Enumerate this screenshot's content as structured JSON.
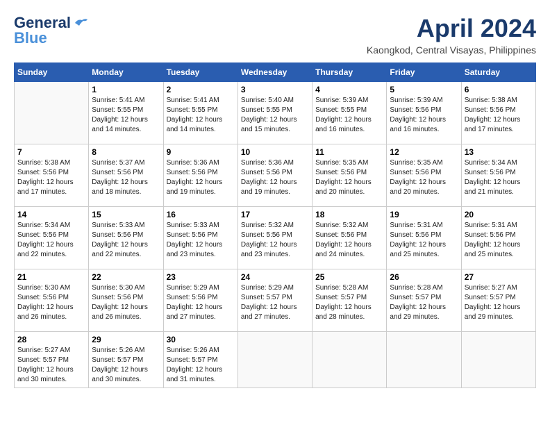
{
  "header": {
    "logo_line1": "General",
    "logo_line2": "Blue",
    "month": "April 2024",
    "location": "Kaongkod, Central Visayas, Philippines"
  },
  "weekdays": [
    "Sunday",
    "Monday",
    "Tuesday",
    "Wednesday",
    "Thursday",
    "Friday",
    "Saturday"
  ],
  "weeks": [
    [
      {
        "day": "",
        "sunrise": "",
        "sunset": "",
        "daylight": ""
      },
      {
        "day": "1",
        "sunrise": "Sunrise: 5:41 AM",
        "sunset": "Sunset: 5:55 PM",
        "daylight": "Daylight: 12 hours and 14 minutes."
      },
      {
        "day": "2",
        "sunrise": "Sunrise: 5:41 AM",
        "sunset": "Sunset: 5:55 PM",
        "daylight": "Daylight: 12 hours and 14 minutes."
      },
      {
        "day": "3",
        "sunrise": "Sunrise: 5:40 AM",
        "sunset": "Sunset: 5:55 PM",
        "daylight": "Daylight: 12 hours and 15 minutes."
      },
      {
        "day": "4",
        "sunrise": "Sunrise: 5:39 AM",
        "sunset": "Sunset: 5:55 PM",
        "daylight": "Daylight: 12 hours and 16 minutes."
      },
      {
        "day": "5",
        "sunrise": "Sunrise: 5:39 AM",
        "sunset": "Sunset: 5:56 PM",
        "daylight": "Daylight: 12 hours and 16 minutes."
      },
      {
        "day": "6",
        "sunrise": "Sunrise: 5:38 AM",
        "sunset": "Sunset: 5:56 PM",
        "daylight": "Daylight: 12 hours and 17 minutes."
      }
    ],
    [
      {
        "day": "7",
        "sunrise": "Sunrise: 5:38 AM",
        "sunset": "Sunset: 5:56 PM",
        "daylight": "Daylight: 12 hours and 17 minutes."
      },
      {
        "day": "8",
        "sunrise": "Sunrise: 5:37 AM",
        "sunset": "Sunset: 5:56 PM",
        "daylight": "Daylight: 12 hours and 18 minutes."
      },
      {
        "day": "9",
        "sunrise": "Sunrise: 5:36 AM",
        "sunset": "Sunset: 5:56 PM",
        "daylight": "Daylight: 12 hours and 19 minutes."
      },
      {
        "day": "10",
        "sunrise": "Sunrise: 5:36 AM",
        "sunset": "Sunset: 5:56 PM",
        "daylight": "Daylight: 12 hours and 19 minutes."
      },
      {
        "day": "11",
        "sunrise": "Sunrise: 5:35 AM",
        "sunset": "Sunset: 5:56 PM",
        "daylight": "Daylight: 12 hours and 20 minutes."
      },
      {
        "day": "12",
        "sunrise": "Sunrise: 5:35 AM",
        "sunset": "Sunset: 5:56 PM",
        "daylight": "Daylight: 12 hours and 20 minutes."
      },
      {
        "day": "13",
        "sunrise": "Sunrise: 5:34 AM",
        "sunset": "Sunset: 5:56 PM",
        "daylight": "Daylight: 12 hours and 21 minutes."
      }
    ],
    [
      {
        "day": "14",
        "sunrise": "Sunrise: 5:34 AM",
        "sunset": "Sunset: 5:56 PM",
        "daylight": "Daylight: 12 hours and 22 minutes."
      },
      {
        "day": "15",
        "sunrise": "Sunrise: 5:33 AM",
        "sunset": "Sunset: 5:56 PM",
        "daylight": "Daylight: 12 hours and 22 minutes."
      },
      {
        "day": "16",
        "sunrise": "Sunrise: 5:33 AM",
        "sunset": "Sunset: 5:56 PM",
        "daylight": "Daylight: 12 hours and 23 minutes."
      },
      {
        "day": "17",
        "sunrise": "Sunrise: 5:32 AM",
        "sunset": "Sunset: 5:56 PM",
        "daylight": "Daylight: 12 hours and 23 minutes."
      },
      {
        "day": "18",
        "sunrise": "Sunrise: 5:32 AM",
        "sunset": "Sunset: 5:56 PM",
        "daylight": "Daylight: 12 hours and 24 minutes."
      },
      {
        "day": "19",
        "sunrise": "Sunrise: 5:31 AM",
        "sunset": "Sunset: 5:56 PM",
        "daylight": "Daylight: 12 hours and 25 minutes."
      },
      {
        "day": "20",
        "sunrise": "Sunrise: 5:31 AM",
        "sunset": "Sunset: 5:56 PM",
        "daylight": "Daylight: 12 hours and 25 minutes."
      }
    ],
    [
      {
        "day": "21",
        "sunrise": "Sunrise: 5:30 AM",
        "sunset": "Sunset: 5:56 PM",
        "daylight": "Daylight: 12 hours and 26 minutes."
      },
      {
        "day": "22",
        "sunrise": "Sunrise: 5:30 AM",
        "sunset": "Sunset: 5:56 PM",
        "daylight": "Daylight: 12 hours and 26 minutes."
      },
      {
        "day": "23",
        "sunrise": "Sunrise: 5:29 AM",
        "sunset": "Sunset: 5:56 PM",
        "daylight": "Daylight: 12 hours and 27 minutes."
      },
      {
        "day": "24",
        "sunrise": "Sunrise: 5:29 AM",
        "sunset": "Sunset: 5:57 PM",
        "daylight": "Daylight: 12 hours and 27 minutes."
      },
      {
        "day": "25",
        "sunrise": "Sunrise: 5:28 AM",
        "sunset": "Sunset: 5:57 PM",
        "daylight": "Daylight: 12 hours and 28 minutes."
      },
      {
        "day": "26",
        "sunrise": "Sunrise: 5:28 AM",
        "sunset": "Sunset: 5:57 PM",
        "daylight": "Daylight: 12 hours and 29 minutes."
      },
      {
        "day": "27",
        "sunrise": "Sunrise: 5:27 AM",
        "sunset": "Sunset: 5:57 PM",
        "daylight": "Daylight: 12 hours and 29 minutes."
      }
    ],
    [
      {
        "day": "28",
        "sunrise": "Sunrise: 5:27 AM",
        "sunset": "Sunset: 5:57 PM",
        "daylight": "Daylight: 12 hours and 30 minutes."
      },
      {
        "day": "29",
        "sunrise": "Sunrise: 5:26 AM",
        "sunset": "Sunset: 5:57 PM",
        "daylight": "Daylight: 12 hours and 30 minutes."
      },
      {
        "day": "30",
        "sunrise": "Sunrise: 5:26 AM",
        "sunset": "Sunset: 5:57 PM",
        "daylight": "Daylight: 12 hours and 31 minutes."
      },
      {
        "day": "",
        "sunrise": "",
        "sunset": "",
        "daylight": ""
      },
      {
        "day": "",
        "sunrise": "",
        "sunset": "",
        "daylight": ""
      },
      {
        "day": "",
        "sunrise": "",
        "sunset": "",
        "daylight": ""
      },
      {
        "day": "",
        "sunrise": "",
        "sunset": "",
        "daylight": ""
      }
    ]
  ]
}
